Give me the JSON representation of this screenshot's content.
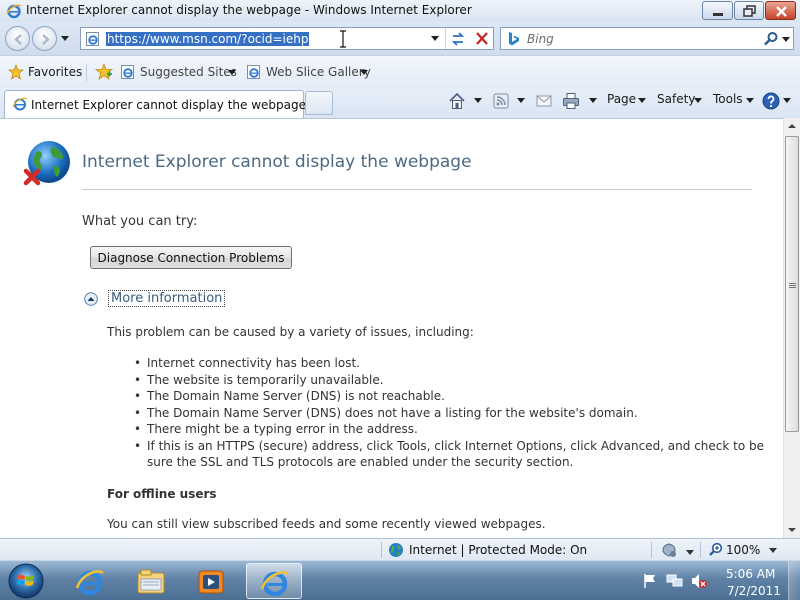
{
  "window": {
    "title": "Internet Explorer cannot display the webpage - Windows Internet Explorer"
  },
  "address_bar": {
    "url": "https://www.msn.com/?ocid=iehp"
  },
  "search": {
    "placeholder": "Bing"
  },
  "favorites_bar": {
    "favorites_label": "Favorites",
    "items": [
      {
        "label": "Suggested Sites",
        "icon": "ie-page-icon"
      },
      {
        "label": "Web Slice Gallery",
        "icon": "ie-page-icon"
      }
    ]
  },
  "tabs": {
    "active_label": "Internet Explorer cannot display the webpage"
  },
  "command_bar": {
    "page_label": "Page",
    "safety_label": "Safety",
    "tools_label": "Tools"
  },
  "page": {
    "title": "Internet Explorer cannot display the webpage",
    "what_you_can_try": "What you can try:",
    "diagnose_button": "Diagnose Connection Problems",
    "more_info_link": "More information",
    "problem_intro": "This problem can be caused by a variety of issues, including:",
    "causes": [
      "Internet connectivity has been lost.",
      "The website is temporarily unavailable.",
      "The Domain Name Server (DNS) is not reachable.",
      "The Domain Name Server (DNS) does not have a listing for the website's domain.",
      "There might be a typing error in the address.",
      "If this is an HTTPS (secure) address, click Tools, click Internet Options, click Advanced, and check to be sure the SSL and TLS protocols are enabled under the security section."
    ],
    "offline_heading": "For offline users",
    "offline_text": "You can still view subscribed feeds and some recently viewed webpages."
  },
  "status_bar": {
    "zone": "Internet | Protected Mode: On",
    "zoom": "100%"
  },
  "taskbar": {
    "time": "5:06 AM",
    "date": "7/2/2011",
    "pinned": [
      "internet-explorer-icon",
      "windows-explorer-icon",
      "media-player-icon",
      "internet-explorer-icon"
    ]
  },
  "colors": {
    "title_text": "#4b6a85",
    "link": "#3b5e80",
    "url_highlight": "#3670c5",
    "taskbar": "#5f82a6"
  }
}
